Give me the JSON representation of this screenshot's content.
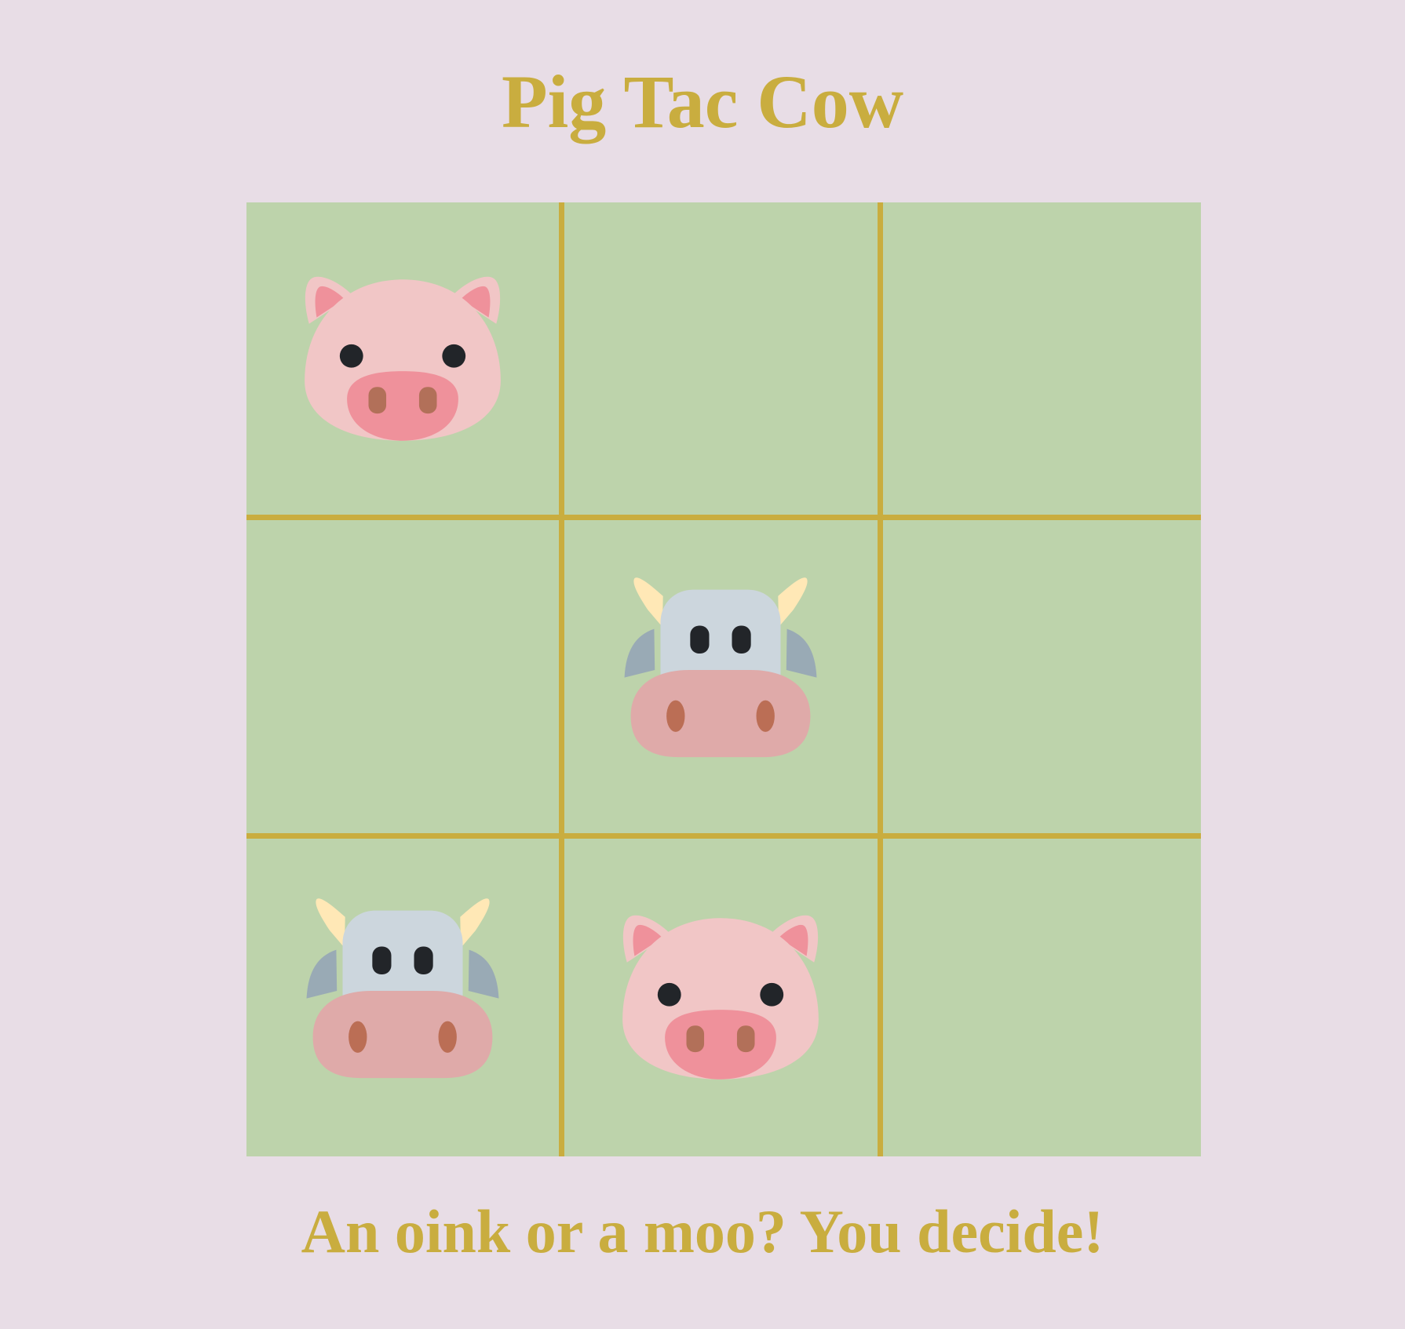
{
  "game": {
    "title": "Pig Tac Cow",
    "tagline": "An oink or a moo? You decide!",
    "board": [
      [
        "pig",
        "",
        ""
      ],
      [
        "",
        "cow",
        ""
      ],
      [
        "cow",
        "pig",
        ""
      ]
    ]
  },
  "colors": {
    "background": "#e8dde6",
    "accent": "#c9ad3f",
    "board": "#bdd3ab",
    "grid_line": "#c9ad3f"
  },
  "icons": {
    "pig": "pig-face-icon",
    "cow": "cow-face-icon"
  }
}
